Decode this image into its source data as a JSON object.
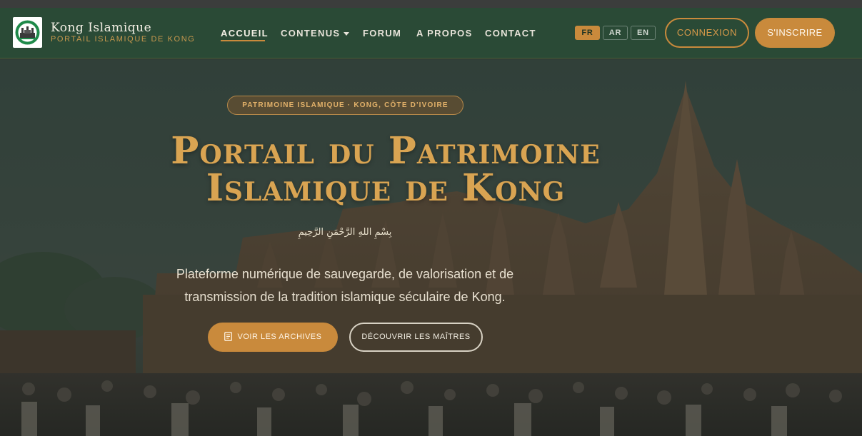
{
  "brand": {
    "title": "Kong Islamique",
    "subtitle": "PORTAIL ISLAMIQUE DE KONG",
    "logo_icon": "mosque-logo-icon"
  },
  "nav": {
    "items": [
      {
        "label": "ACCUEIL",
        "active": true
      },
      {
        "label": "CONTENUS",
        "has_dropdown": true
      },
      {
        "label": "FORUM"
      },
      {
        "label": "A PROPOS"
      },
      {
        "label": "CONTACT"
      }
    ],
    "languages": [
      {
        "label": "FR",
        "active": true
      },
      {
        "label": "AR"
      },
      {
        "label": "EN"
      }
    ],
    "login_label": "CONNEXION",
    "signup_label": "S'INSCRIRE"
  },
  "hero": {
    "badge": "PATRIMOINE ISLAMIQUE · KONG, CÔTE D'IVOIRE",
    "title_line1": "Portail du Patrimoine",
    "title_line2": "Islamique de Kong",
    "basmala": "بِسْمِ اللهِ الرَّحْمَنِ الرَّحِيمِ",
    "description_line1": "Plateforme numérique de sauvegarde, de valorisation et de",
    "description_line2": "transmission de la tradition islamique séculaire de Kong.",
    "primary_button": "VOIR LES ARCHIVES",
    "primary_button_icon": "document-icon",
    "secondary_button": "DÉCOUVRIR LES MAÎTRES"
  },
  "colors": {
    "navbar_bg": "#2a4a36",
    "accent": "#c98a3c",
    "title_gold": "#d9a452"
  }
}
